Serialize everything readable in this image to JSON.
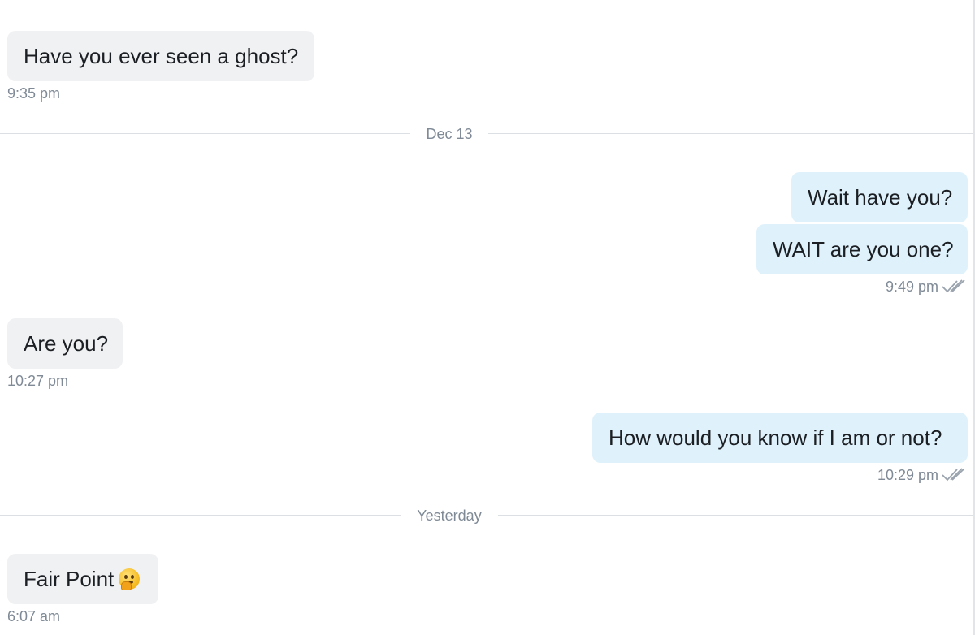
{
  "conversation": {
    "messages": [
      {
        "direction": "incoming",
        "text": "Have you ever seen a ghost?",
        "time": "9:35 pm"
      },
      {
        "direction": "outgoing",
        "text": "Wait have you?"
      },
      {
        "direction": "outgoing",
        "text": "WAIT are you one?",
        "time": "9:49 pm",
        "read": true
      },
      {
        "direction": "incoming",
        "text": "Are you?",
        "time": "10:27 pm"
      },
      {
        "direction": "outgoing",
        "text": "How would you know if I am or not?",
        "time": "10:29 pm",
        "read": true
      },
      {
        "direction": "incoming",
        "text": "Fair Point",
        "emoji": "thinking-face",
        "time": "6:07 am"
      }
    ],
    "dividers": [
      "Dec 13",
      "Yesterday"
    ]
  },
  "colors": {
    "incoming_bubble": "#f0f1f3",
    "outgoing_bubble": "#dff2fc",
    "timestamp": "#7f8a96",
    "read_checkmarks": "#9aa3ad"
  }
}
